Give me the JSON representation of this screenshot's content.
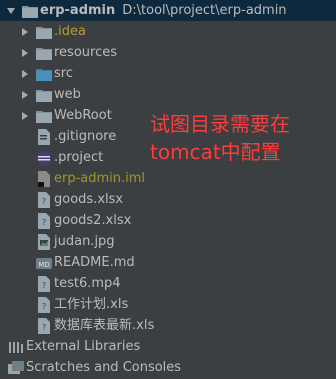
{
  "project": {
    "name": "erp-admin",
    "path": "D:\\tool\\project\\erp-admin"
  },
  "items": [
    {
      "label": ".idea",
      "icon": "folder-icon"
    },
    {
      "label": "resources",
      "icon": "folder-icon"
    },
    {
      "label": "src",
      "icon": "source-folder-icon"
    },
    {
      "label": "web",
      "icon": "folder-icon"
    },
    {
      "label": "WebRoot",
      "icon": "folder-icon"
    },
    {
      "label": ".gitignore",
      "icon": "file-icon"
    },
    {
      "label": ".project",
      "icon": "eclipse-project-icon"
    },
    {
      "label": "erp-admin.iml",
      "icon": "iml-file-icon"
    },
    {
      "label": "goods.xlsx",
      "icon": "file-icon"
    },
    {
      "label": "goods2.xlsx",
      "icon": "file-icon"
    },
    {
      "label": "judan.jpg",
      "icon": "image-file-icon"
    },
    {
      "label": "README.md",
      "icon": "markdown-file-icon"
    },
    {
      "label": "test6.mp4",
      "icon": "file-icon"
    },
    {
      "label": "工作计划.xls",
      "icon": "file-icon"
    },
    {
      "label": "数据库表最新.xls",
      "icon": "file-icon"
    }
  ],
  "external_libraries": "External Libraries",
  "scratches": "Scratches and Consoles",
  "annotation": {
    "line1": "试图目录需要在",
    "line2": "tomcat中配置"
  },
  "colors": {
    "background": "#3c3f41",
    "selected_row": "#0d293e",
    "folder_blue": "#87939a",
    "text": "#bbbbbb",
    "annotation_red": "#ff3b3b",
    "idea_color": "#b59b37",
    "iml_color": "#9a9a2b"
  }
}
